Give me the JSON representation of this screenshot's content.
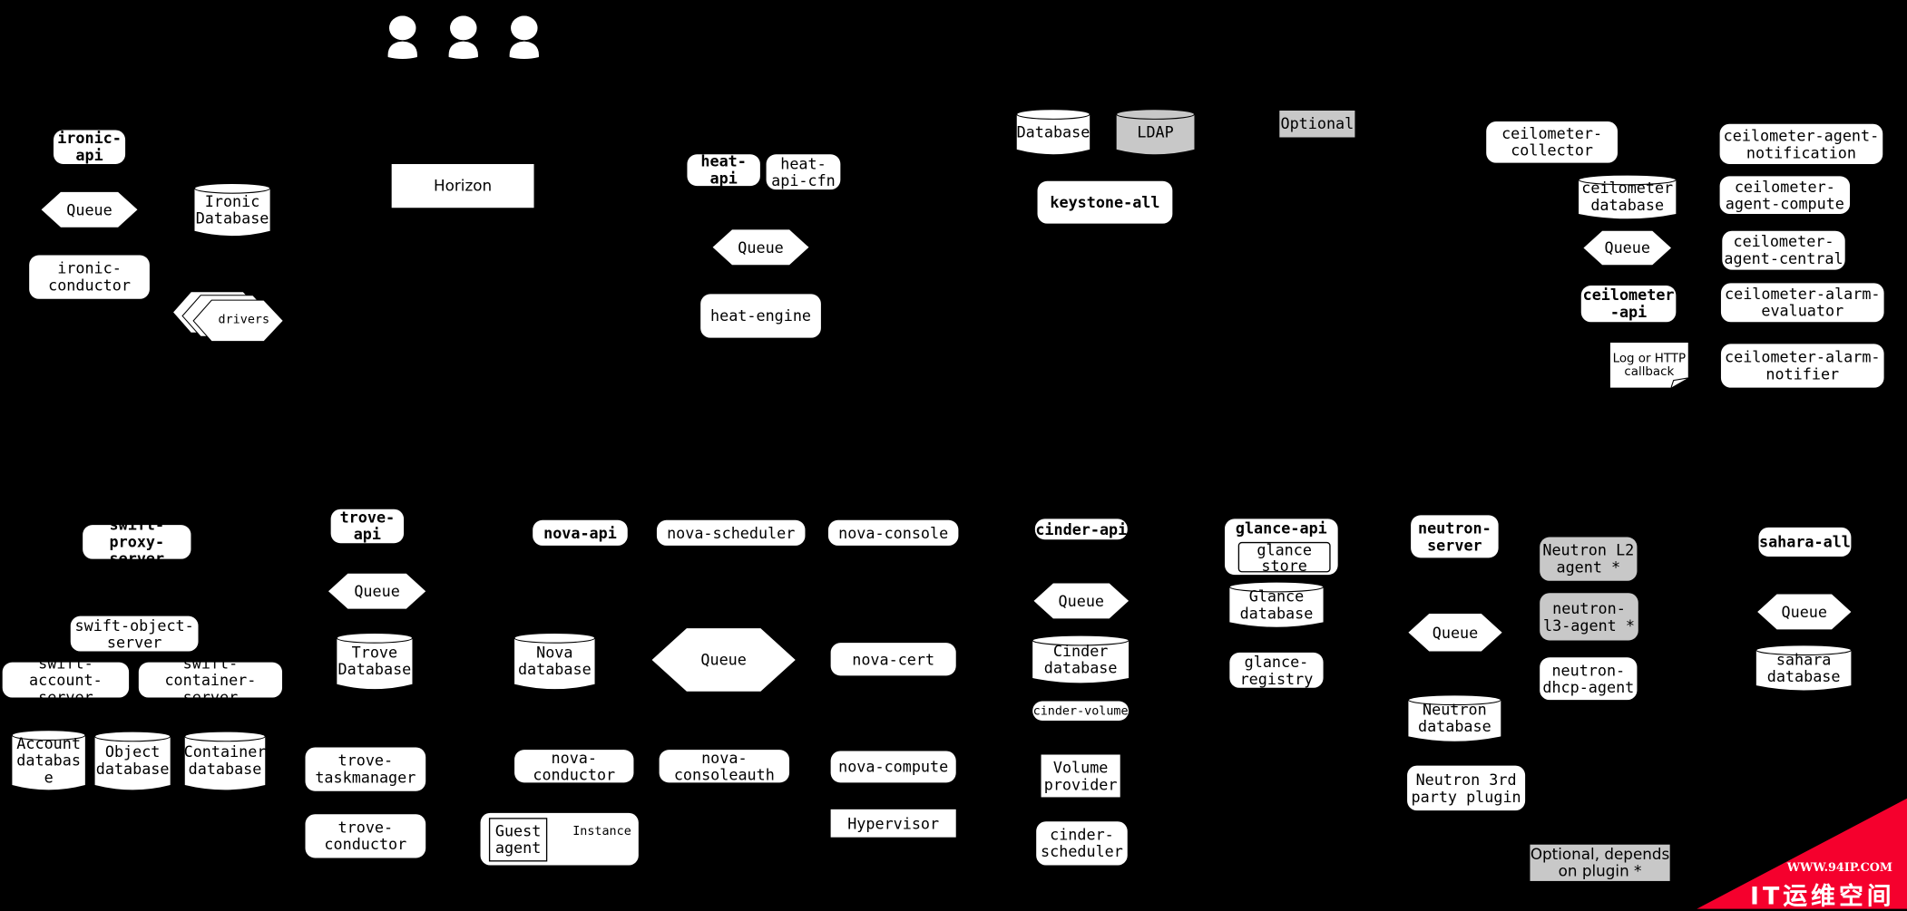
{
  "colors": {
    "background": "#000000",
    "node": "#ffffff",
    "optional": "#c8c8c8",
    "watermark": "#f5002d"
  },
  "users": {
    "icon": "person-icon",
    "count": 3
  },
  "nodes": {
    "ironic_api": "ironic-\napi",
    "ironic_queue": "Queue",
    "ironic_db": "Ironic\nDatabase",
    "ironic_conductor": "ironic-\nconductor",
    "drivers": "drivers",
    "horizon": "Horizon",
    "heat_api": "heat-api",
    "heat_api_cfn": "heat-\napi-cfn",
    "heat_queue": "Queue",
    "heat_engine": "heat-engine",
    "keystone_db": "Database",
    "ldap": "LDAP",
    "optional": "Optional",
    "keystone_all": "keystone-all",
    "ceilometer_collector": "ceilometer-\ncollector",
    "ceilometer_db": "ceilometer\ndatabase",
    "ceilometer_queue": "Queue",
    "ceilometer_api": "ceilometer\n-api",
    "log_callback": "Log or  HTTP\ncallback",
    "agent_notification": "ceilometer-agent-\nnotification",
    "agent_compute": "ceilometer-\nagent-compute",
    "agent_central": "ceilometer-\nagent-central",
    "alarm_evaluator": "ceilometer-alarm-\nevaluator",
    "alarm_notifier": "ceilometer-alarm-\nnotifier",
    "swift_proxy": "swift-proxy-\nserver",
    "swift_object": "swift-object-\nserver",
    "swift_account": "swift-account-\nserver",
    "swift_container": "swift-container-\nserver",
    "account_db": "Account\ndatabas\ne",
    "object_db": "Object\ndatabase",
    "container_db": "Container\ndatabase",
    "trove_api": "trove-\napi",
    "trove_queue": "Queue",
    "trove_db": "Trove\nDatabase",
    "trove_taskmanager": "trove-\ntaskmanager",
    "trove_conductor": "trove-\nconductor",
    "nova_api": "nova-api",
    "nova_scheduler": "nova-scheduler",
    "nova_console": "nova-console",
    "nova_db": "Nova\ndatabase",
    "nova_queue": "Queue",
    "nova_cert": "nova-cert",
    "nova_conductor": "nova-\nconductor",
    "nova_consoleauth": "nova-\nconsoleauth",
    "nova_compute": "nova-compute",
    "instance": "Instance",
    "guest_agent": "Guest\nagent",
    "hypervisor": "Hypervisor",
    "cinder_api": "cinder-api",
    "cinder_queue": "Queue",
    "cinder_db": "Cinder\ndatabase",
    "cinder_volume": "cinder-volume",
    "volume_provider": "Volume\nprovider",
    "cinder_scheduler": "cinder-\nscheduler",
    "glance_api": "glance-api",
    "glance_store": "glance\nstore",
    "glance_db": "Glance\ndatabase",
    "glance_registry": "glance-\nregistry",
    "neutron_server": "neutron-\nserver",
    "neutron_queue": "Queue",
    "neutron_db": "Neutron\ndatabase",
    "neutron_plugin": "Neutron 3rd\nparty plugin",
    "neutron_l2": "Neutron L2\nagent *",
    "neutron_l3": "neutron-\nl3-agent *",
    "neutron_dhcp": "neutron-\ndhcp-agent",
    "optional_plugin": "Optional, depends\non plugin *",
    "sahara_all": "sahara-all",
    "sahara_queue": "Queue",
    "sahara_db": "sahara\ndatabase"
  },
  "watermark": {
    "url": "WWW.94IP.COM",
    "name": "IT运维空间"
  }
}
